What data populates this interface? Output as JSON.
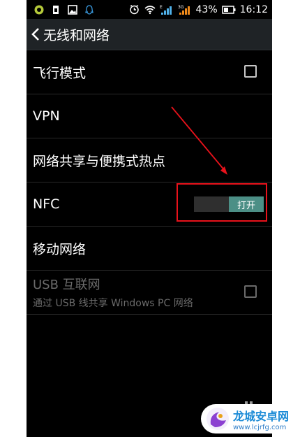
{
  "statusbar": {
    "battery_percent": "43%",
    "time": "16:12",
    "icons": [
      "usb-debug-icon",
      "sim-icon",
      "gallery-icon",
      "qq-icon",
      "alarm-icon",
      "wifi-icon",
      "signal-e-icon",
      "signal-3g-icon",
      "battery-icon"
    ],
    "signal_labels": [
      "E",
      "3G"
    ]
  },
  "actionbar": {
    "back_icon": "chevron-left-icon",
    "title": "无线和网络"
  },
  "settings": [
    {
      "label": "飞行模式",
      "control": "checkbox",
      "checked": false
    },
    {
      "label": "VPN"
    },
    {
      "label": "网络共享与便携式热点"
    },
    {
      "label": "NFC",
      "control": "toggle",
      "toggle_text": "打开",
      "on": true
    },
    {
      "label": "移动网络"
    },
    {
      "label": "USB 互联网",
      "sub": "通过 USB 线共享 Windows PC 网络",
      "control": "checkbox",
      "checked": false,
      "disabled": true
    }
  ],
  "annotation": {
    "color": "#e8121b",
    "type": "arrow-and-box",
    "target": "NFC toggle"
  },
  "watermark": {
    "title": "龙城安卓网",
    "url": "www.lcjrfg.com"
  },
  "colors": {
    "background": "#000000",
    "actionbar": "#1f2326",
    "toggle_on": "#4c8f86",
    "annotation": "#e8121b",
    "watermark_text": "#1a8ad6"
  }
}
